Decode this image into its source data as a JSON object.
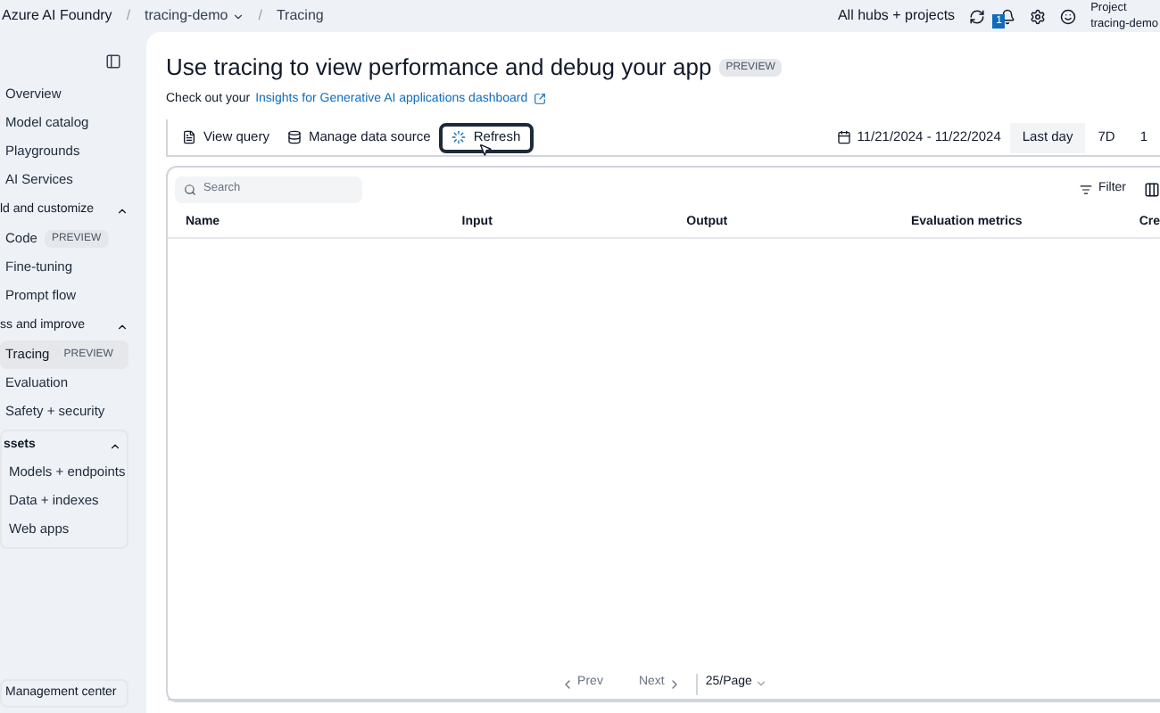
{
  "top_bar": {
    "app_name": "Azure AI Foundry",
    "separator": "/",
    "breadcrumbs": [
      {
        "label": "tracing-demo",
        "kind": "dropdown"
      },
      {
        "label": "Tracing",
        "kind": "plain"
      }
    ],
    "scope": "All hubs + projects",
    "notification_count": "1",
    "project_label": "Project",
    "project_name": "tracing-demo"
  },
  "sidebar": {
    "items": [
      {
        "label": "Overview",
        "kind": "item",
        "selected": false
      },
      {
        "label": "Model catalog",
        "kind": "item",
        "selected": false
      },
      {
        "label": "Playgrounds",
        "kind": "item",
        "selected": false
      },
      {
        "label": "AI Services",
        "kind": "item",
        "selected": false
      },
      {
        "label": "ld and customize",
        "kind": "section",
        "expanded": true
      },
      {
        "label": "Code",
        "badge": "PREVIEW",
        "kind": "item",
        "selected": false
      },
      {
        "label": "Fine-tuning",
        "kind": "item",
        "selected": false
      },
      {
        "label": "Prompt flow",
        "kind": "item",
        "selected": false
      },
      {
        "label": "ss and improve",
        "kind": "section",
        "expanded": true
      },
      {
        "label": "Tracing",
        "badge": "PREVIEW",
        "kind": "item",
        "selected": true
      },
      {
        "label": "Evaluation",
        "kind": "item",
        "selected": false
      },
      {
        "label": "Safety + security",
        "kind": "item",
        "selected": false
      }
    ],
    "assets": {
      "label": "ssets",
      "expanded": true,
      "items": [
        {
          "label": "Models + endpoints",
          "selected": false
        },
        {
          "label": "Data + indexes",
          "selected": false
        },
        {
          "label": "Web apps",
          "selected": false
        }
      ]
    },
    "footer": "Management center"
  },
  "page": {
    "title": "Use tracing to view performance and debug your app",
    "badge": "PREVIEW",
    "intro": "Check out your",
    "link": "Insights for Generative AI applications dashboard",
    "toolbar": [
      {
        "label": "View query",
        "kind": "query",
        "focused": false
      },
      {
        "label": "Manage data source",
        "kind": "source",
        "focused": false
      },
      {
        "label": "Refresh",
        "kind": "refresh",
        "focused": true
      }
    ],
    "date_range": "11/21/2024 - 11/22/2024",
    "ranges": [
      {
        "label": "Last day",
        "selected": true
      },
      {
        "label": "7D",
        "selected": false
      },
      {
        "label": "1",
        "selected": false
      }
    ],
    "search": {
      "placeholder": "Search"
    },
    "filter": "Filter",
    "table": {
      "columns": [
        "Name",
        "Input",
        "Output",
        "Evaluation metrics",
        "Cre"
      ]
    },
    "pagination": {
      "prev": "Prev",
      "next": "Next",
      "prev_disabled": true,
      "next_disabled": true,
      "page_size": "25/Page"
    }
  }
}
